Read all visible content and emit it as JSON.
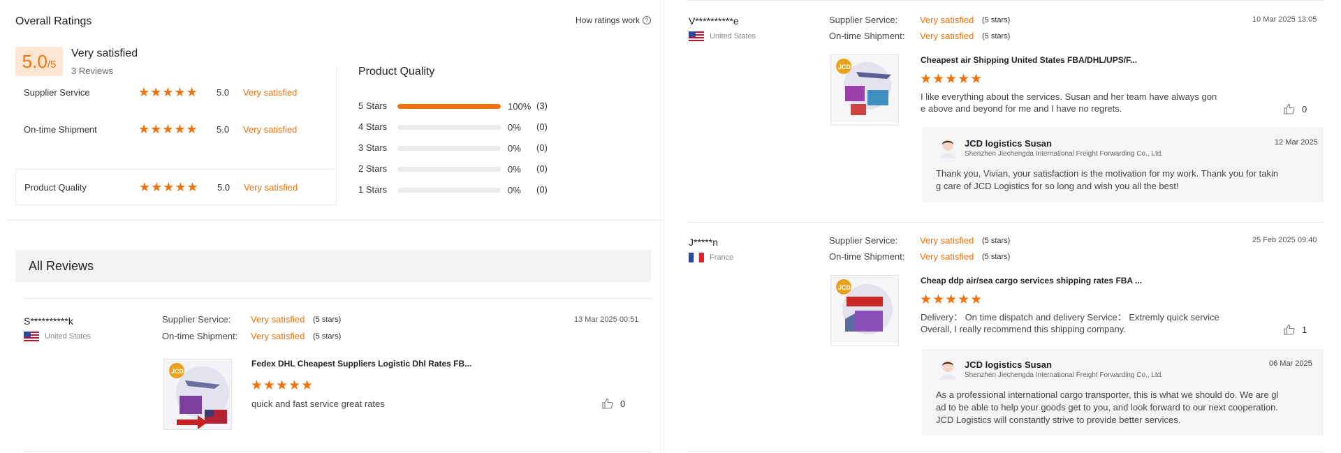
{
  "overall": {
    "title": "Overall Ratings",
    "how_link": "How ratings work",
    "score": "5.0",
    "score_max": "/5",
    "summary": "Very satisfied",
    "review_count": "3 Reviews",
    "rows": [
      {
        "label": "Supplier Service",
        "stars": 5,
        "value": "5.0",
        "text": "Very satisfied"
      },
      {
        "label": "On-time Shipment",
        "stars": 5,
        "value": "5.0",
        "text": "Very satisfied"
      },
      {
        "label": "Product Quality",
        "stars": 5,
        "value": "5.0",
        "text": "Very satisfied"
      }
    ]
  },
  "product_quality": {
    "title": "Product Quality",
    "distribution": [
      {
        "label": "5 Stars",
        "fraction": 1.0,
        "pct": "100%",
        "count": "(3)"
      },
      {
        "label": "4 Stars",
        "fraction": 0,
        "pct": "0%",
        "count": "(0)"
      },
      {
        "label": "3 Stars",
        "fraction": 0,
        "pct": "0%",
        "count": "(0)"
      },
      {
        "label": "2 Stars",
        "fraction": 0,
        "pct": "0%",
        "count": "(0)"
      },
      {
        "label": "1 Stars",
        "fraction": 0,
        "pct": "0%",
        "count": "(0)"
      }
    ]
  },
  "all_reviews": {
    "title": "All Reviews"
  },
  "criteria_labels": {
    "supplier": "Supplier Service:",
    "shipment": "On-time Shipment:"
  },
  "reviews": [
    {
      "name": "S**********k",
      "country": "United States",
      "supplier": "Very satisfied",
      "supplier_stars": "(5 stars)",
      "shipment": "Very satisfied",
      "shipment_stars": "(5 stars)",
      "date": "13 Mar 2025 00:51",
      "product_title": "Fedex DHL Cheapest Suppliers Logistic Dhl Rates FB...",
      "stars": 5,
      "text": "quick and fast service great rates",
      "likes": "0"
    },
    {
      "name": "V**********e",
      "country": "United States",
      "supplier": "Very satisfied",
      "supplier_stars": "(5 stars)",
      "shipment": "Very satisfied",
      "shipment_stars": "(5 stars)",
      "date": "10 Mar 2025 13:05",
      "product_title": "Cheapest air Shipping United States FBA/DHL/UPS/F...",
      "stars": 5,
      "text_lines": [
        "I like everything about the services. Susan and her team have always gon",
        "e above and beyond for me and I have no regrets."
      ],
      "likes": "0",
      "reply": {
        "name": "JCD logistics Susan",
        "company": "Shenzhen Jiechengda International Freight Forwarding Co., Ltd.",
        "date": "12 Mar 2025",
        "lines": [
          "Thank you, Vivian, your satisfaction is the motivation for my work. Thank you for takin",
          "g care of JCD Logistics for so long and wish you all the best!"
        ]
      }
    },
    {
      "name": "J*****n",
      "country": "France",
      "supplier": "Very satisfied",
      "supplier_stars": "(5 stars)",
      "shipment": "Very satisfied",
      "shipment_stars": "(5 stars)",
      "date": "25 Feb 2025 09:40",
      "product_title": "Cheap ddp air/sea cargo services shipping rates FBA ...",
      "stars": 5,
      "text_lines": [
        "Delivery： On time dispatch and delivery Service： Extremly quick service",
        "Overall, I really recommend this shipping company."
      ],
      "likes": "1",
      "reply": {
        "name": "JCD logistics Susan",
        "company": "Shenzhen Jiechengda International Freight Forwarding Co., Ltd.",
        "date": "06 Mar 2025",
        "lines": [
          "As a professional international cargo transporter, this is what we should do. We are gl",
          "ad to be able to help your goods get to you, and look forward to our next cooperation.",
          "JCD Logistics will constantly strive to provide better services."
        ]
      }
    }
  ],
  "colors": {
    "accent": "#f0720e",
    "accent_light": "#fde6d2",
    "panel_bg": "#f2f3f5"
  }
}
